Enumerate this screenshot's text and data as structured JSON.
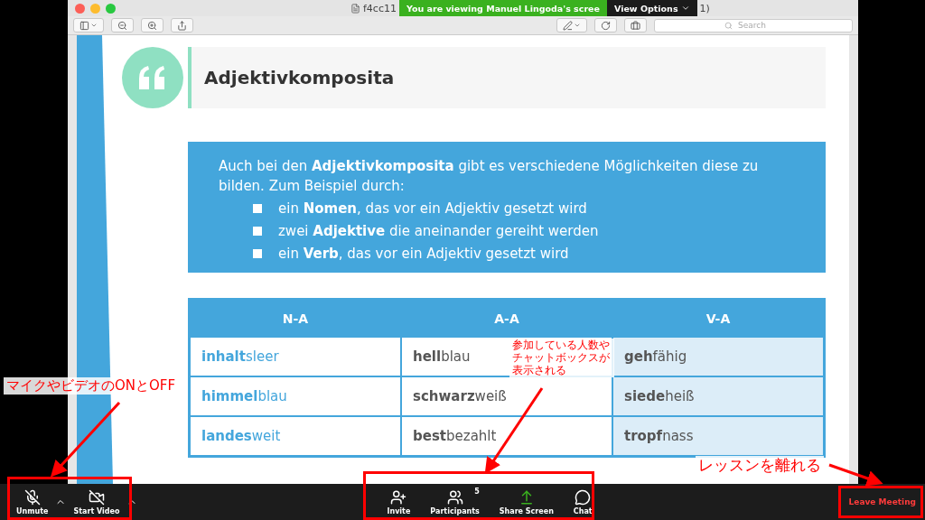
{
  "window": {
    "title_left": "f4cc11",
    "title_right": "1)"
  },
  "share_banner": {
    "text": "You are viewing Manuel Lingoda's scree",
    "options": "View Options"
  },
  "toolbar": {
    "search": {
      "placeholder": "Search"
    }
  },
  "slide": {
    "title": "Adjektivkomposita",
    "intro": "Auch bei den **Adjektivkomposita** gibt es verschiedene Möglichkeiten diese zu bilden. Zum Beispiel durch:",
    "bullets": [
      "ein **Nomen**, das vor ein Adjektiv gesetzt wird",
      "zwei **Adjektive** die aneinander gereiht werden",
      "ein **Verb**, das vor ein Adjektiv gesetzt wird"
    ],
    "table": {
      "columns": [
        "N-A",
        "A-A",
        "V-A"
      ],
      "rows": [
        [
          "**inhalt**sleer",
          "**hell**blau",
          "**geh**fähig"
        ],
        [
          "**himmel**blau",
          "**schwarz**weiß",
          "**siede**heiß"
        ],
        [
          "**landes**weit",
          "**best**bezahlt",
          "**tropf**nass"
        ]
      ]
    }
  },
  "meeting_bar": {
    "left": [
      {
        "kind": "audio",
        "label": "Unmute",
        "muted": true
      },
      {
        "kind": "video",
        "label": "Start Video",
        "on": false
      }
    ],
    "center": [
      {
        "kind": "invite",
        "label": "Invite"
      },
      {
        "kind": "participants",
        "label": "Participants",
        "count": "5"
      },
      {
        "kind": "share",
        "label": "Share Screen"
      },
      {
        "kind": "chat",
        "label": "Chat"
      }
    ],
    "leave": "Leave Meeting"
  },
  "annotations": [
    {
      "kind": "left",
      "text": "マイクやビデオのONとOFF"
    },
    {
      "kind": "center",
      "text": "参加している人数やチャットボックスが表示される"
    },
    {
      "kind": "right",
      "text": "レッスンを離れる"
    }
  ]
}
